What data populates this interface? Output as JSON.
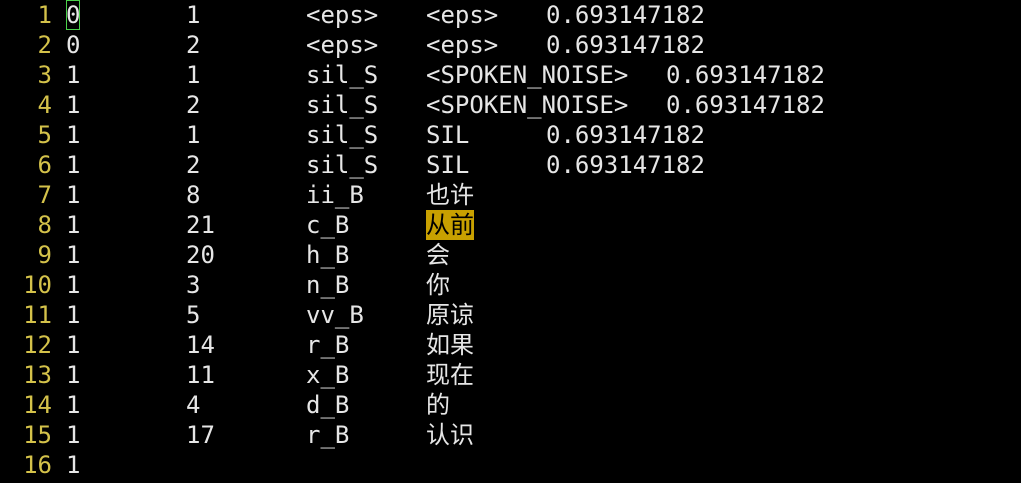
{
  "colors": {
    "background": "#000000",
    "text": "#e6e6e6",
    "line_number": "#d4c24a",
    "cursor_outline": "#4bd24b",
    "search_highlight": "#c8a000"
  },
  "lines": [
    {
      "num": "1",
      "c1": "0",
      "c2": "1",
      "c3": "<eps>",
      "c4": "<eps>",
      "c5": "0.693147182"
    },
    {
      "num": "2",
      "c1": "0",
      "c2": "2",
      "c3": "<eps>",
      "c4": "<eps>",
      "c5": "0.693147182"
    },
    {
      "num": "3",
      "c1": "1",
      "c2": "1",
      "c3": "sil_S",
      "c4": "<SPOKEN_NOISE>",
      "c5": "0.693147182"
    },
    {
      "num": "4",
      "c1": "1",
      "c2": "2",
      "c3": "sil_S",
      "c4": "<SPOKEN_NOISE>",
      "c5": "0.693147182"
    },
    {
      "num": "5",
      "c1": "1",
      "c2": "1",
      "c3": "sil_S",
      "c4": "SIL",
      "c5": "0.693147182"
    },
    {
      "num": "6",
      "c1": "1",
      "c2": "2",
      "c3": "sil_S",
      "c4": "SIL",
      "c5": "0.693147182"
    },
    {
      "num": "7",
      "c1": "1",
      "c2": "8",
      "c3": "ii_B",
      "c4": "也许",
      "c5": ""
    },
    {
      "num": "8",
      "c1": "1",
      "c2": "21",
      "c3": "c_B",
      "c4": "从前",
      "c5": ""
    },
    {
      "num": "9",
      "c1": "1",
      "c2": "20",
      "c3": "h_B",
      "c4": "会",
      "c5": ""
    },
    {
      "num": "10",
      "c1": "1",
      "c2": "3",
      "c3": "n_B",
      "c4": "你",
      "c5": ""
    },
    {
      "num": "11",
      "c1": "1",
      "c2": "5",
      "c3": "vv_B",
      "c4": "原谅",
      "c5": ""
    },
    {
      "num": "12",
      "c1": "1",
      "c2": "14",
      "c3": "r_B",
      "c4": "如果",
      "c5": ""
    },
    {
      "num": "13",
      "c1": "1",
      "c2": "11",
      "c3": "x_B",
      "c4": "现在",
      "c5": ""
    },
    {
      "num": "14",
      "c1": "1",
      "c2": "4",
      "c3": "d_B",
      "c4": "的",
      "c5": ""
    },
    {
      "num": "15",
      "c1": "1",
      "c2": "17",
      "c3": "r_B",
      "c4": "认识",
      "c5": ""
    },
    {
      "num": "16",
      "c1": "1",
      "c2": "",
      "c3": "",
      "c4": "",
      "c5": ""
    }
  ],
  "cursor_line": 1,
  "search_highlight_line": 8
}
